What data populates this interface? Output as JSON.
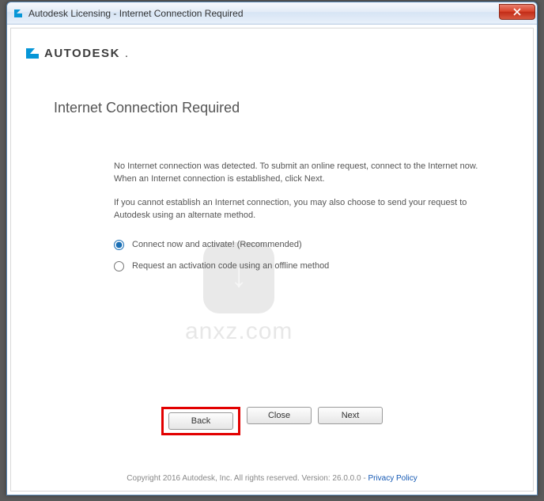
{
  "window": {
    "title": "Autodesk Licensing - Internet Connection Required"
  },
  "brand": {
    "name": "AUTODESK"
  },
  "heading": "Internet Connection Required",
  "paragraphs": {
    "p1": "No Internet connection was detected. To submit an online request, connect to the Internet now. When an Internet connection is established, click Next.",
    "p2": "If you cannot establish an Internet connection, you may also choose to send your request to Autodesk using an alternate method."
  },
  "options": {
    "opt1": "Connect now and activate! (Recommended)",
    "opt2": "Request an activation code using an offline method"
  },
  "buttons": {
    "back": "Back",
    "close": "Close",
    "next": "Next"
  },
  "footer": {
    "copyright": "Copyright 2016 Autodesk, Inc. All rights reserved. Version: 26.0.0.0 - ",
    "privacy": "Privacy Policy"
  },
  "watermark": {
    "text": "anxz.com"
  }
}
